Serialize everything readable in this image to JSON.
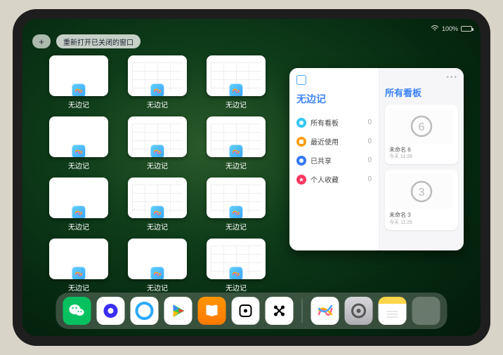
{
  "status": {
    "battery_pct": "100%"
  },
  "top": {
    "add_label": "+",
    "reopen_label": "重新打开已关闭的窗口"
  },
  "thumb_label": "无边记",
  "thumbs": [
    {
      "variant": "blank"
    },
    {
      "variant": "grid"
    },
    {
      "variant": "grid"
    },
    {
      "variant": "blank"
    },
    {
      "variant": "grid"
    },
    {
      "variant": "grid"
    },
    {
      "variant": "blank"
    },
    {
      "variant": "grid"
    },
    {
      "variant": "grid"
    },
    {
      "variant": "blank"
    },
    {
      "variant": "blank"
    },
    {
      "variant": "grid"
    }
  ],
  "preview": {
    "left_title": "无边记",
    "right_title": "所有看板",
    "menu": [
      {
        "icon_color": "#34c7f5",
        "label": "所有看板",
        "count": "0"
      },
      {
        "icon_color": "#ff9f0a",
        "label": "最近使用",
        "count": "0"
      },
      {
        "icon_color": "#3478f6",
        "label": "已共享",
        "count": "0"
      },
      {
        "icon_color": "#ff375f",
        "label": "个人收藏",
        "count": "0"
      }
    ],
    "boards": [
      {
        "name": "未命名 6",
        "date": "今天 11:28",
        "glyph": "6"
      },
      {
        "name": "未命名 3",
        "date": "今天 11:25",
        "glyph": "3"
      }
    ]
  },
  "dock": {
    "apps": [
      {
        "id": "wechat"
      },
      {
        "id": "quark"
      },
      {
        "id": "qqbrowser"
      },
      {
        "id": "play"
      },
      {
        "id": "books"
      },
      {
        "id": "dice"
      },
      {
        "id": "dots"
      }
    ],
    "recent": [
      {
        "id": "freeform"
      },
      {
        "id": "settings"
      },
      {
        "id": "notes"
      },
      {
        "id": "folder"
      }
    ]
  }
}
